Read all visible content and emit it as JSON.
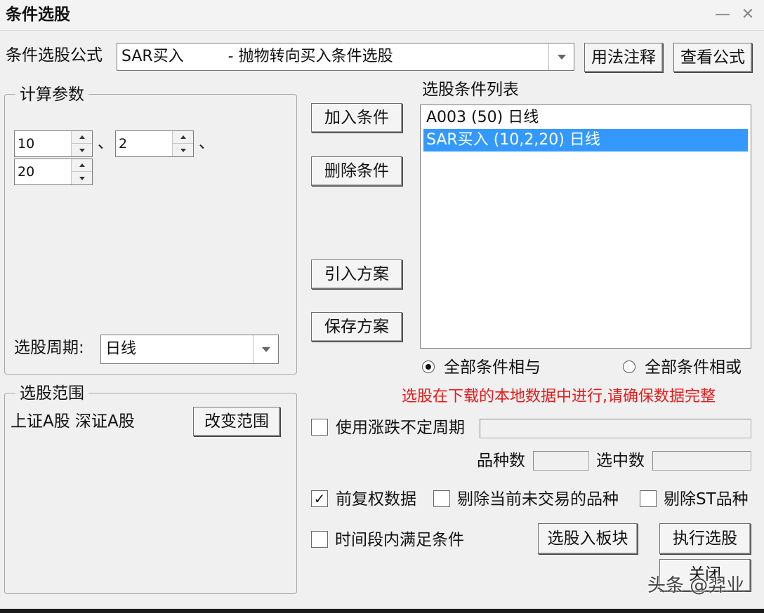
{
  "window": {
    "title": "条件选股"
  },
  "formula": {
    "label": "条件选股公式",
    "selected": "SAR买入         - 抛物转向买入条件选股",
    "usage_button": "用法注释",
    "view_button": "查看公式"
  },
  "params": {
    "group_label": "计算参数",
    "values": [
      "10",
      "2",
      "20"
    ],
    "separator": "、",
    "period_label": "选股周期:",
    "period_value": "日线"
  },
  "actions": {
    "add": "加入条件",
    "delete": "删除条件",
    "import": "引入方案",
    "save": "保存方案"
  },
  "conditions": {
    "label": "选股条件列表",
    "items": [
      "A003 (50) 日线",
      "SAR买入 (10,2,20) 日线"
    ],
    "selected_index": 1,
    "and_label": "全部条件相与",
    "or_label": "全部条件相或",
    "mode": "and"
  },
  "scope": {
    "group_label": "选股范围",
    "value": "上证A股 深证A股",
    "change_button": "改变范围"
  },
  "warning": "选股在下载的本地数据中进行,请确保数据完整",
  "options": {
    "irregular_period_label": "使用涨跌不定周期",
    "irregular_period_checked": false,
    "variety_count_label": "品种数",
    "selected_count_label": "选中数",
    "adjust_label": "前复权数据",
    "adjust_checked": true,
    "exclude_untraded_label": "剔除当前未交易的品种",
    "exclude_untraded_checked": false,
    "exclude_st_label": "剔除ST品种",
    "exclude_st_checked": false,
    "time_range_label": "时间段内满足条件",
    "time_range_checked": false
  },
  "footer": {
    "to_block_button": "选股入板块",
    "execute_button": "执行选股",
    "close_button": "关闭"
  },
  "watermark": "头条 @羿业"
}
